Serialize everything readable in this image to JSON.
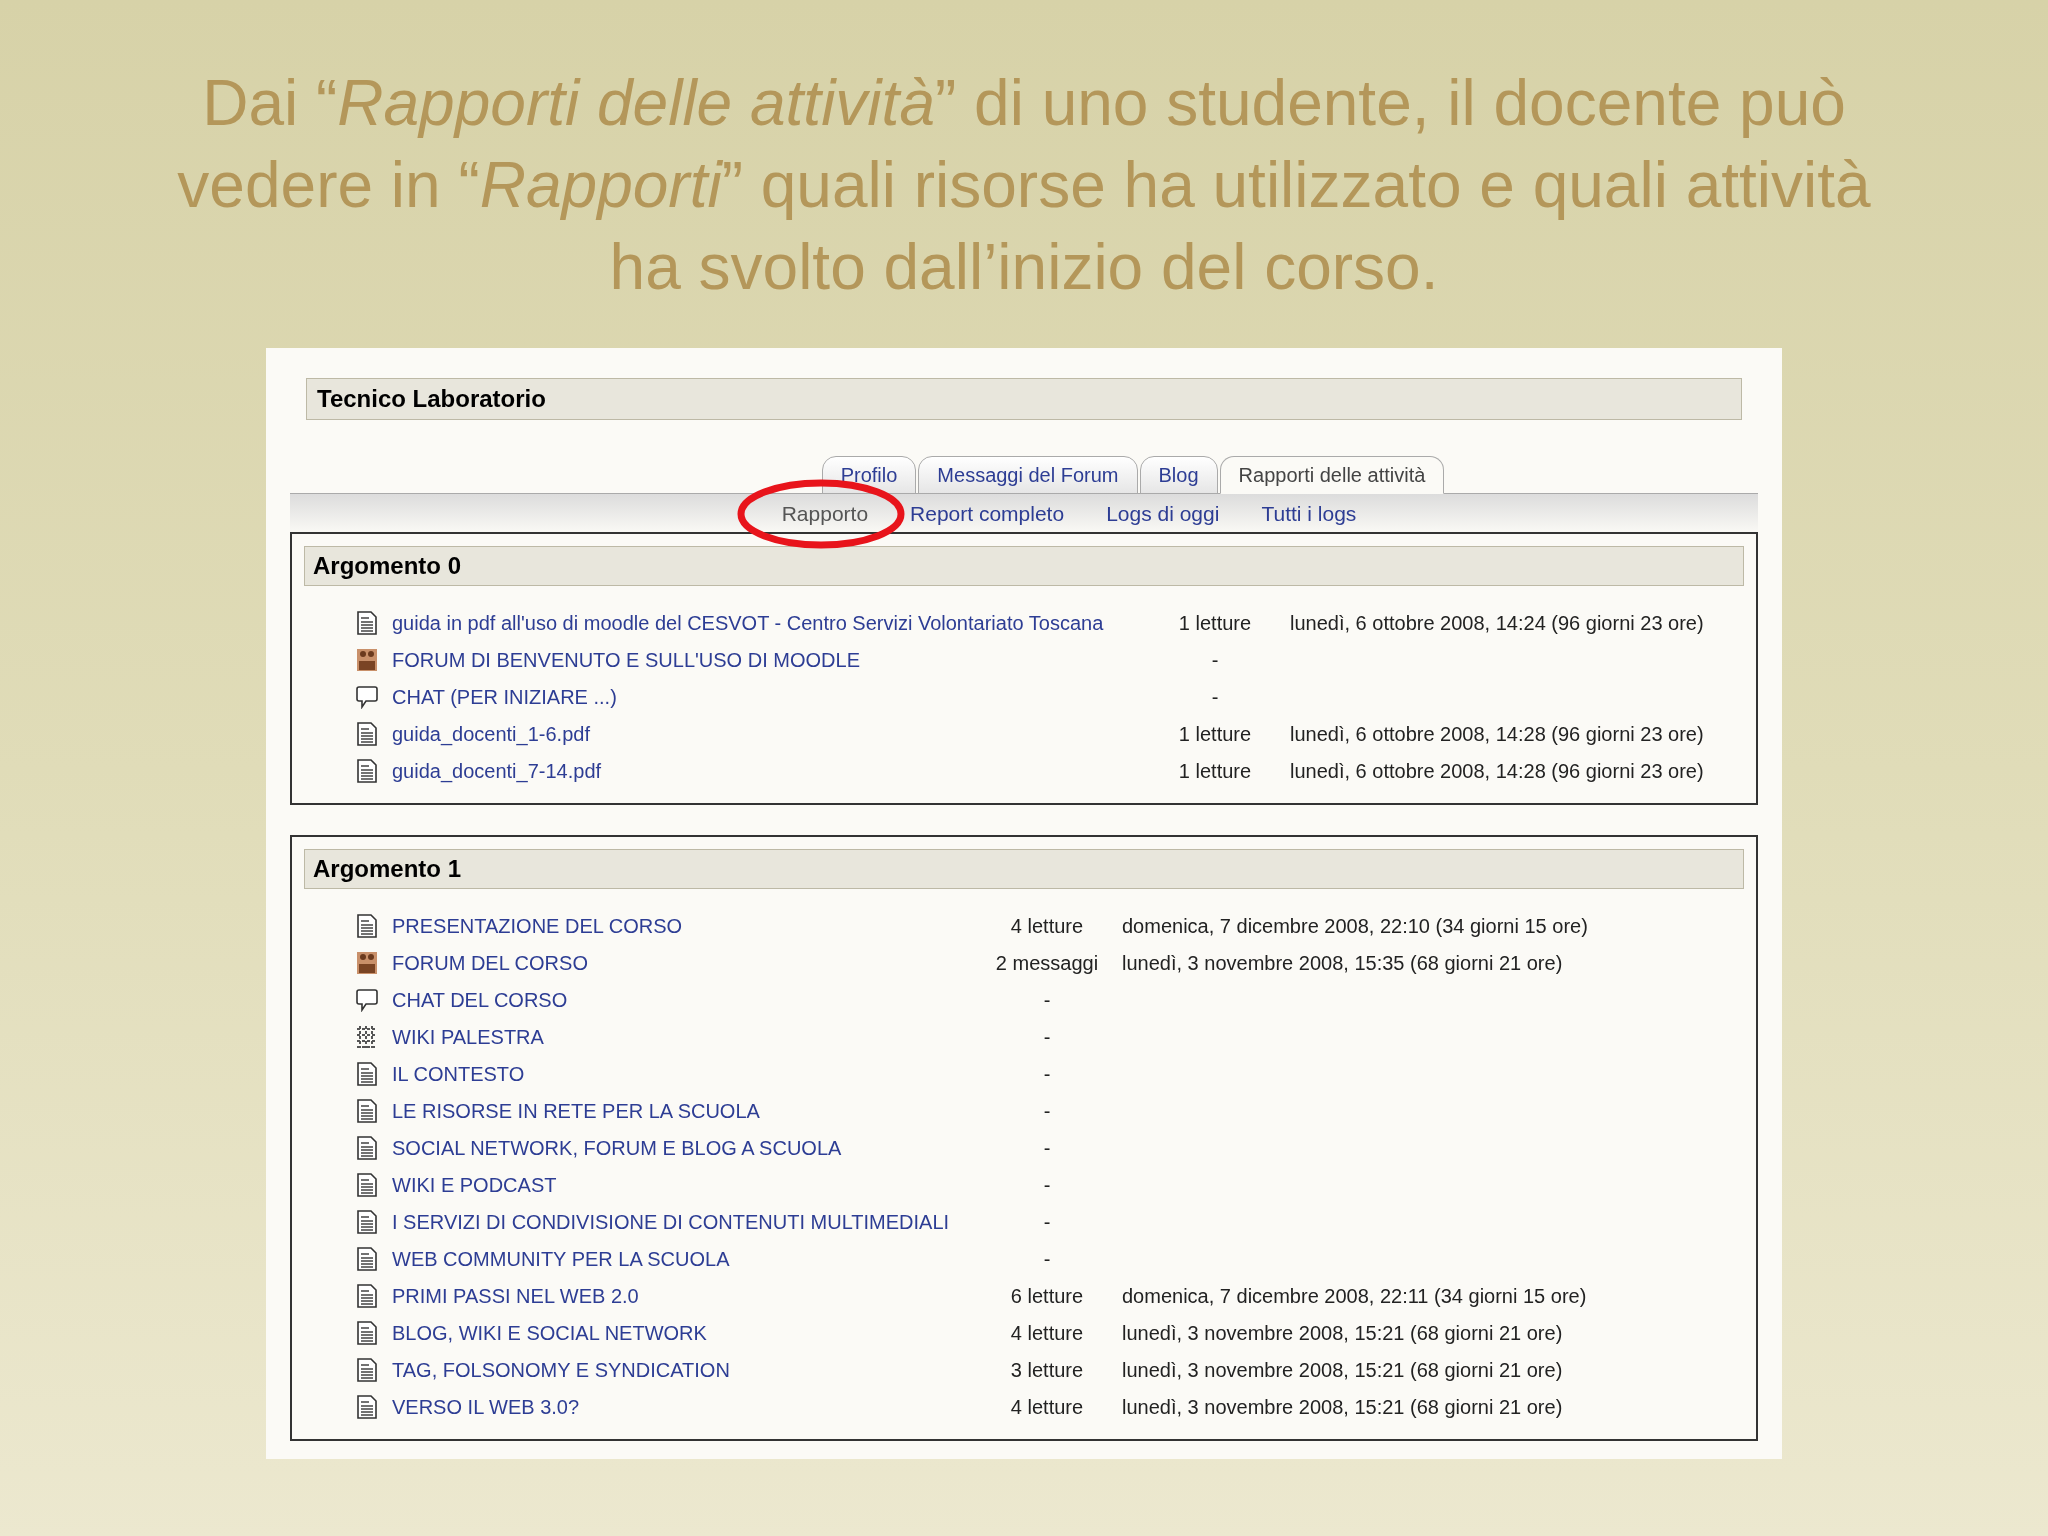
{
  "slide_title": "Dai “*Rapporti delle attività*” di uno studente, il docente può vedere in “*Rapporti*” quali risorse ha utilizzato e quali attività ha svolto dall’inizio del corso.",
  "user_header": "Tecnico Laboratorio",
  "tabs": [
    {
      "label": "Profilo",
      "selected": false
    },
    {
      "label": "Messaggi del Forum",
      "selected": false
    },
    {
      "label": "Blog",
      "selected": false
    },
    {
      "label": "Rapporti delle attività",
      "selected": true
    }
  ],
  "subtabs": [
    {
      "label": "Rapporto",
      "selected": true,
      "circled": true
    },
    {
      "label": "Report completo",
      "selected": false,
      "circled": false
    },
    {
      "label": "Logs di oggi",
      "selected": false,
      "circled": false
    },
    {
      "label": "Tutti i logs",
      "selected": false,
      "circled": false
    }
  ],
  "sections": [
    {
      "title": "Argomento 0",
      "rows": [
        {
          "kind": "resource",
          "name": "guida in pdf all'uso di moodle del CESVOT - Centro Servizi Volontariato Toscana",
          "count": "1 letture",
          "last_access": "lunedì, 6 ottobre 2008, 14:24 (96 giorni 23 ore)"
        },
        {
          "kind": "forum",
          "name": "FORUM DI BENVENUTO E SULL'USO DI MOODLE",
          "count": "-"
        },
        {
          "kind": "chat",
          "name": "CHAT (PER INIZIARE ...)",
          "count": "-"
        },
        {
          "kind": "resource",
          "name": "guida_docenti_1-6.pdf",
          "count": "1 letture",
          "last_access": "lunedì, 6 ottobre 2008, 14:28 (96 giorni 23 ore)"
        },
        {
          "kind": "resource",
          "name": "guida_docenti_7-14.pdf",
          "count": "1 letture",
          "last_access": "lunedì, 6 ottobre 2008, 14:28 (96 giorni 23 ore)"
        }
      ]
    },
    {
      "title": "Argomento 1",
      "rows": [
        {
          "kind": "resource",
          "name": "PRESENTAZIONE DEL CORSO",
          "count": "4 letture",
          "last_access": "domenica, 7 dicembre 2008, 22:10 (34 giorni 15 ore)"
        },
        {
          "kind": "forum",
          "name": "FORUM DEL CORSO",
          "count": "2 messaggi",
          "last_access": "lunedì, 3 novembre 2008, 15:35 (68 giorni 21 ore)"
        },
        {
          "kind": "chat",
          "name": "CHAT DEL CORSO",
          "count": "-"
        },
        {
          "kind": "wiki",
          "name": "WIKI PALESTRA",
          "count": "-"
        },
        {
          "kind": "resource",
          "name": "IL CONTESTO",
          "count": "-"
        },
        {
          "kind": "resource",
          "name": "LE RISORSE IN RETE PER LA SCUOLA",
          "count": "-"
        },
        {
          "kind": "resource",
          "name": "SOCIAL NETWORK, FORUM E BLOG A SCUOLA",
          "count": "-"
        },
        {
          "kind": "resource",
          "name": "WIKI E PODCAST",
          "count": "-"
        },
        {
          "kind": "resource",
          "name": "I SERVIZI DI CONDIVISIONE DI CONTENUTI MULTIMEDIALI",
          "count": "-"
        },
        {
          "kind": "resource",
          "name": "WEB COMMUNITY PER LA SCUOLA",
          "count": "-"
        },
        {
          "kind": "resource",
          "name": "PRIMI PASSI NEL WEB 2.0",
          "count": "6 letture",
          "last_access": "domenica, 7 dicembre 2008, 22:11 (34 giorni 15 ore)"
        },
        {
          "kind": "resource",
          "name": "BLOG, WIKI E SOCIAL NETWORK",
          "count": "4 letture",
          "last_access": "lunedì, 3 novembre 2008, 15:21 (68 giorni 21 ore)"
        },
        {
          "kind": "resource",
          "name": "TAG, FOLSONOMY E SYNDICATION",
          "count": "3 letture",
          "last_access": "lunedì, 3 novembre 2008, 15:21 (68 giorni 21 ore)"
        },
        {
          "kind": "resource",
          "name": "VERSO IL WEB 3.0?",
          "count": "4 letture",
          "last_access": "lunedì, 3 novembre 2008, 15:21 (68 giorni 21 ore)"
        }
      ]
    }
  ]
}
